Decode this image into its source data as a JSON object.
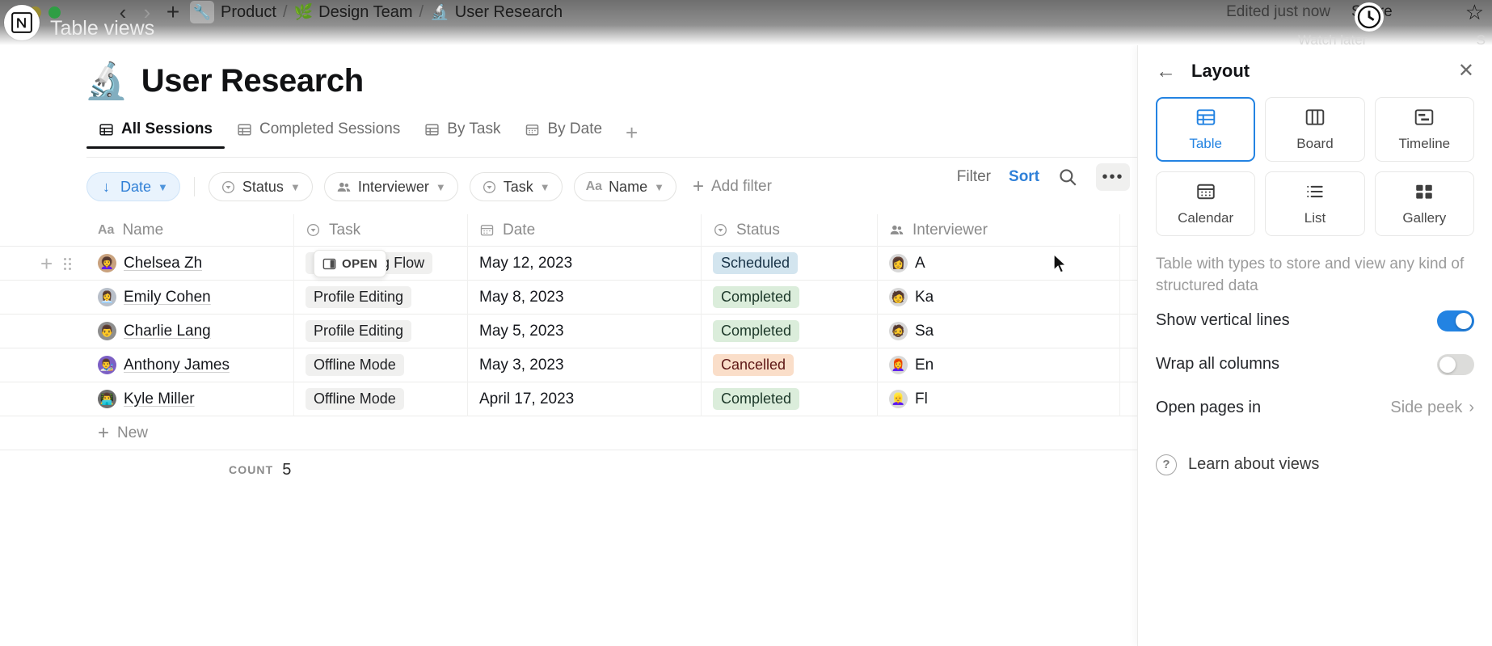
{
  "window": {
    "title_label": "Table views",
    "app_logo": "notion-logo",
    "traffic_lights": [
      "close",
      "minimize",
      "zoom"
    ],
    "breadcrumbs": [
      {
        "emoji": "🔧",
        "label": "Product"
      },
      {
        "emoji": "🌿",
        "label": "Design Team"
      },
      {
        "emoji": "🔬",
        "label": "User Research"
      }
    ],
    "breadcrumb_separator": "/",
    "edited_status": "Edited just now",
    "share_label": "Share",
    "star_icon": "star-icon",
    "nav_back_icon": "chevron-left-icon",
    "nav_forward_icon": "chevron-right-icon",
    "new_tab_icon": "plus-icon",
    "sidebar_toggle_icon": "hamburger-icon"
  },
  "overlay": {
    "watch_later_label": "Watch later",
    "share_label": "S",
    "clock_icon": "clock-icon"
  },
  "header": {
    "emoji": "🔬",
    "title": "User Research"
  },
  "tabs": [
    {
      "label": "All Sessions",
      "icon": "table-icon",
      "active": true
    },
    {
      "label": "Completed Sessions",
      "icon": "table-icon",
      "active": false
    },
    {
      "label": "By Task",
      "icon": "table-icon",
      "active": false
    },
    {
      "label": "By Date",
      "icon": "calendar-icon",
      "active": false
    }
  ],
  "tabs_add_label": "+",
  "toolbar": {
    "filter_label": "Filter",
    "sort_label": "Sort",
    "search_icon": "search-icon",
    "more_label": "•••",
    "new_label": "New",
    "new_caret": "⌄"
  },
  "filters": {
    "chips": [
      {
        "label": "Date",
        "icon": "arrow-down-icon",
        "active": true
      },
      {
        "label": "Status",
        "icon": "select-icon",
        "active": false
      },
      {
        "label": "Interviewer",
        "icon": "people-icon",
        "active": false
      },
      {
        "label": "Task",
        "icon": "select-icon",
        "active": false
      },
      {
        "label": "Name",
        "icon": "aa-icon",
        "active": false
      }
    ],
    "add_filter_label": "Add filter",
    "caret": "⌄"
  },
  "table": {
    "columns": [
      {
        "label": "Name",
        "icon": "aa-icon"
      },
      {
        "label": "Task",
        "icon": "select-icon"
      },
      {
        "label": "Date",
        "icon": "calendar-icon"
      },
      {
        "label": "Status",
        "icon": "select-icon"
      },
      {
        "label": "Interviewer",
        "icon": "people-icon"
      }
    ],
    "rows": [
      {
        "name": "Chelsea Zh",
        "avatar": "👩‍🦱",
        "task": "Onboarding Flow",
        "date": "May 12, 2023",
        "status": "Scheduled",
        "status_color": "scheduled",
        "interviewer": "A",
        "interviewer_avatar": "👩"
      },
      {
        "name": "Emily Cohen",
        "avatar": "👩‍💼",
        "task": "Profile Editing",
        "date": "May 8, 2023",
        "status": "Completed",
        "status_color": "completed",
        "interviewer": "Ka",
        "interviewer_avatar": "🧑"
      },
      {
        "name": "Charlie Lang",
        "avatar": "👨",
        "task": "Profile Editing",
        "date": "May 5, 2023",
        "status": "Completed",
        "status_color": "completed",
        "interviewer": "Sa",
        "interviewer_avatar": "🧔"
      },
      {
        "name": "Anthony James",
        "avatar": "👨‍🎨",
        "task": "Offline Mode",
        "date": "May 3, 2023",
        "status": "Cancelled",
        "status_color": "cancelled",
        "interviewer": "En",
        "interviewer_avatar": "👩‍🦰"
      },
      {
        "name": "Kyle Miller",
        "avatar": "👨‍💻",
        "task": "Offline Mode",
        "date": "April 17, 2023",
        "status": "Completed",
        "status_color": "completed",
        "interviewer": "Fl",
        "interviewer_avatar": "👱‍♀️"
      }
    ],
    "open_button_label": "OPEN",
    "new_row_label": "New",
    "count_label": "COUNT",
    "count_value": "5"
  },
  "panel": {
    "title": "Layout",
    "back_icon": "arrow-left-icon",
    "close_icon": "close-icon",
    "layouts": [
      {
        "label": "Table",
        "icon": "table-icon",
        "selected": true
      },
      {
        "label": "Board",
        "icon": "board-icon",
        "selected": false
      },
      {
        "label": "Timeline",
        "icon": "timeline-icon",
        "selected": false
      },
      {
        "label": "Calendar",
        "icon": "calendar-icon",
        "selected": false
      },
      {
        "label": "List",
        "icon": "list-icon",
        "selected": false
      },
      {
        "label": "Gallery",
        "icon": "gallery-icon",
        "selected": false
      }
    ],
    "description": "Table with types to store and view any kind of structured data",
    "options": [
      {
        "label": "Show vertical lines",
        "type": "toggle",
        "value": "on"
      },
      {
        "label": "Wrap all columns",
        "type": "toggle",
        "value": "off"
      },
      {
        "label": "Open pages in",
        "type": "value",
        "value": "Side peek"
      }
    ],
    "learn_label": "Learn about views",
    "help_icon": "question-icon"
  },
  "colors": {
    "accent": "#2383e2",
    "scheduled": "#d3e5ef",
    "completed": "#dbeddb",
    "cancelled": "#fadec9"
  }
}
